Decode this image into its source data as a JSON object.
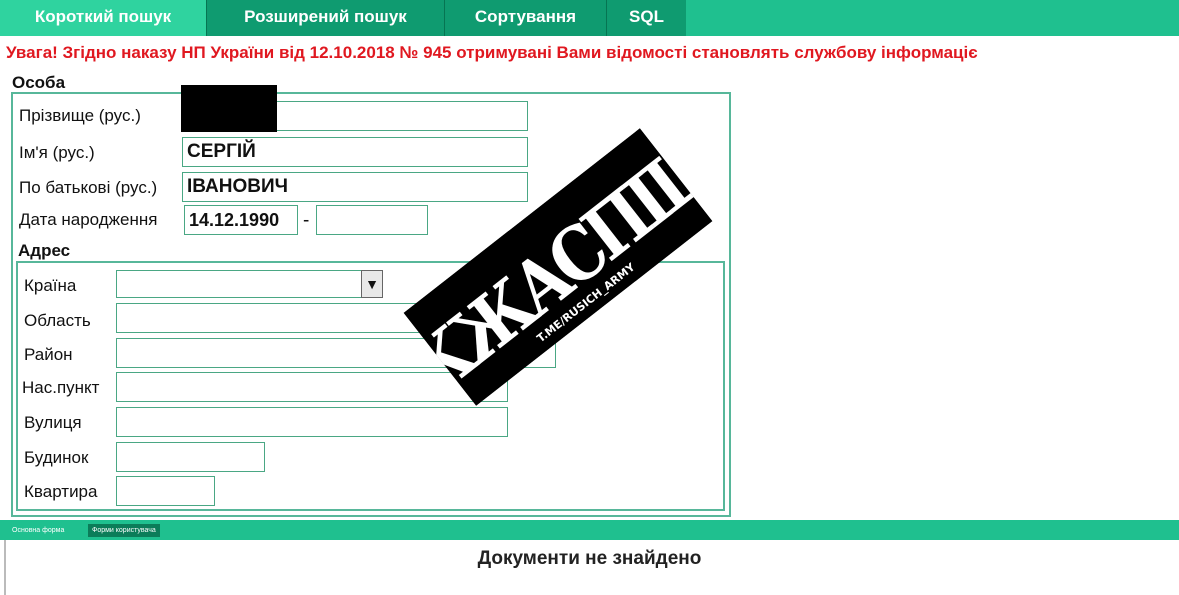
{
  "tabs": [
    {
      "label": "Короткий пошук",
      "active": true
    },
    {
      "label": "Розширений пошук",
      "active": false
    },
    {
      "label": "Сортування",
      "active": false
    },
    {
      "label": "SQL",
      "active": false
    }
  ],
  "warning": "Увага! Згідно наказу НП України від 12.10.2018 № 945 отримувані Вами відомості становлять службову інформаціє",
  "person": {
    "section_title": "Особа",
    "surname_label": "Прізвище (рус.)",
    "surname_value": "",
    "name_label": "Ім'я (рус.)",
    "name_value": "СЕРГІЙ",
    "patronymic_label": "По батькові (рус.)",
    "patronymic_value": "ІВАНОВИЧ",
    "birth_label": "Дата народження",
    "birth_from": "14.12.1990",
    "birth_separator": "-",
    "birth_to": ""
  },
  "address": {
    "section_title": "Адрес",
    "country_label": "Країна",
    "country_value": "",
    "region_label": "Область",
    "district_label": "Район",
    "locality_label": "Нас.пункт",
    "street_label": "Вулиця",
    "house_label": "Будинок",
    "apartment_label": "Квартира"
  },
  "bottom_tabs": [
    "Основна форма",
    "Форми користувача"
  ],
  "result_message": "Документи не знайдено",
  "stamp": {
    "text_main": "ЖЖЖАСПІЦИЯ",
    "text_handle": "T.ME/RUSICH_ARMY"
  },
  "colors": {
    "accent": "#1fc08f",
    "tab_dark": "#0f9b70",
    "warning": "#e01820",
    "border": "#4aa784"
  }
}
